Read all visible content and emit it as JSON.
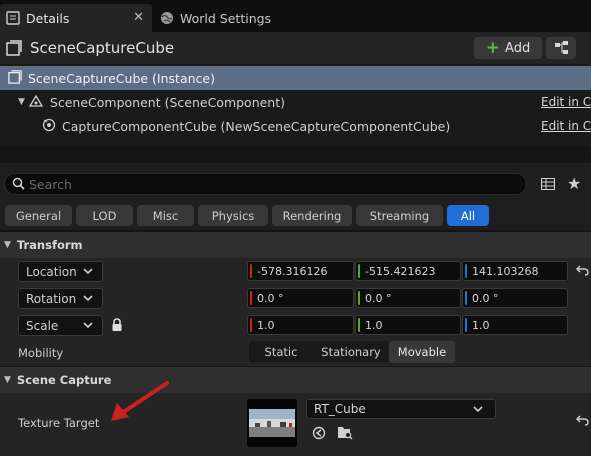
{
  "tabs": {
    "details_label": "Details",
    "world_settings_label": "World Settings"
  },
  "header": {
    "actor_name": "SceneCaptureCube",
    "add_label": "Add"
  },
  "tree": {
    "rows": [
      {
        "label": "SceneCaptureCube (Instance)",
        "edit": ""
      },
      {
        "label": "SceneComponent (SceneComponent)",
        "edit": "Edit in C++"
      },
      {
        "label": "CaptureComponentCube (NewSceneCaptureComponentCube)",
        "edit": "Edit in C++"
      }
    ]
  },
  "search": {
    "placeholder": "Search"
  },
  "filters": [
    "General",
    "LOD",
    "Misc",
    "Physics",
    "Rendering",
    "Streaming",
    "All"
  ],
  "transform": {
    "section_label": "Transform",
    "location": {
      "label": "Location",
      "x": "-578.316126",
      "y": "-515.421623",
      "z": "141.103268"
    },
    "rotation": {
      "label": "Rotation",
      "x": "0.0 °",
      "y": "0.0 °",
      "z": "0.0 °"
    },
    "scale": {
      "label": "Scale",
      "x": "1.0",
      "y": "1.0",
      "z": "1.0"
    },
    "mobility": {
      "label": "Mobility",
      "options": [
        "Static",
        "Stationary",
        "Movable"
      ],
      "selected": "Movable"
    }
  },
  "scene_capture": {
    "section_label": "Scene Capture",
    "texture_target_label": "Texture Target",
    "texture_target_value": "RT_Cube"
  },
  "colors": {
    "x_axis": "#c8261e",
    "y_axis": "#5fa52b",
    "z_axis": "#2f6fd0",
    "selected_row": "#5c6e85",
    "active_filter": "#1f6fd6",
    "annotation_arrow": "#d11f1f"
  }
}
